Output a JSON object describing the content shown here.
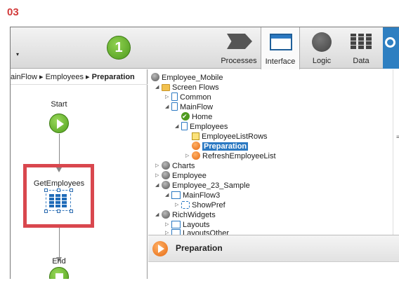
{
  "step": "03",
  "toolbar": {
    "badge": "1",
    "dropdown_arrow": "▾",
    "tabs": [
      {
        "label": "Processes",
        "icon": "processes-icon"
      },
      {
        "label": "Interface",
        "icon": "interface-icon",
        "active": true
      },
      {
        "label": "Logic",
        "icon": "logic-icon"
      },
      {
        "label": "Data",
        "icon": "data-icon"
      }
    ],
    "search_icon": "search-icon"
  },
  "breadcrumb": {
    "parts": [
      "ainFlow",
      "Employees"
    ],
    "separator": "▸",
    "current": "Preparation"
  },
  "flow": {
    "start_label": "Start",
    "action_label": "GetEmployees",
    "end_label": "End",
    "highlight_color": "#d9474e"
  },
  "tree": {
    "root": "Employee_Mobile",
    "items": [
      {
        "label": "Screen Flows"
      },
      {
        "label": "Common"
      },
      {
        "label": "MainFlow"
      },
      {
        "label": "Home"
      },
      {
        "label": "Employees"
      },
      {
        "label": "EmployeeListRows"
      },
      {
        "label": "Preparation",
        "selected": true
      },
      {
        "label": "RefreshEmployeeList"
      },
      {
        "label": "Charts"
      },
      {
        "label": "Employee"
      },
      {
        "label": "Employee_23_Sample"
      },
      {
        "label": "MainFlow3"
      },
      {
        "label": "ShowPref"
      },
      {
        "label": "RichWidgets"
      },
      {
        "label": "Layouts"
      },
      {
        "label": "LayoutsOther"
      }
    ]
  },
  "properties": {
    "title": "Preparation"
  },
  "colors": {
    "accent": "#2b79c2",
    "green": "#4e9a1e",
    "orange": "#e56a12"
  }
}
